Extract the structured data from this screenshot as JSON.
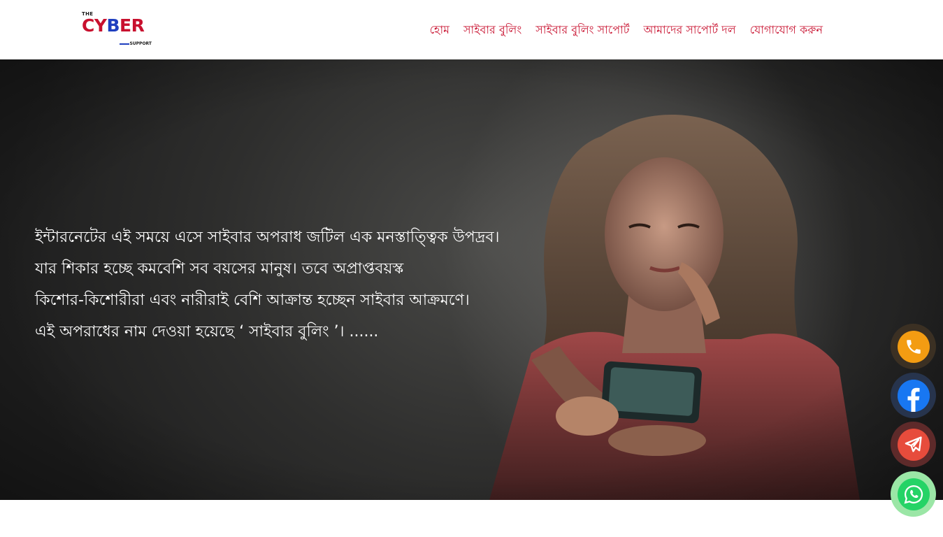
{
  "logo": {
    "the": "THE",
    "cy": "CY",
    "b": "B",
    "er": "ER",
    "support": "SUPPORT"
  },
  "nav": {
    "items": [
      {
        "label": "হোম"
      },
      {
        "label": "সাইবার বুলিং"
      },
      {
        "label": "সাইবার বুলিং সাপোর্ট"
      },
      {
        "label": "আমাদের সাপোর্ট দল"
      },
      {
        "label": "যোগাযোগ করুন"
      }
    ]
  },
  "hero": {
    "lines": [
      "ইন্টারনেটের এই সময়ে এসে সাইবার অপরাধ জটিল এক মনস্তাত্ত্বিক উপদ্রব।",
      "যার শিকার হচ্ছে কমবেশি সব বয়সের মানুষ। তবে অপ্রাপ্তবয়স্ক",
      "কিশোর-কিশোরীরা এবং নারীরাই বেশি আক্রান্ত হচ্ছেন সাইবার আক্রমণে।",
      "এই অপরাধের নাম দেওয়া হয়েছে ‘ সাইবার বুলিং ’। ......"
    ]
  },
  "floating_buttons": [
    {
      "icon": "phone-icon",
      "color": "#f39c12"
    },
    {
      "icon": "facebook-icon",
      "color": "#1877f2"
    },
    {
      "icon": "telegram-icon",
      "color": "#e74c3c"
    },
    {
      "icon": "whatsapp-icon",
      "color": "#25d366"
    }
  ],
  "colors": {
    "brand_red": "#c8102e",
    "brand_blue": "#1f3fbf"
  }
}
